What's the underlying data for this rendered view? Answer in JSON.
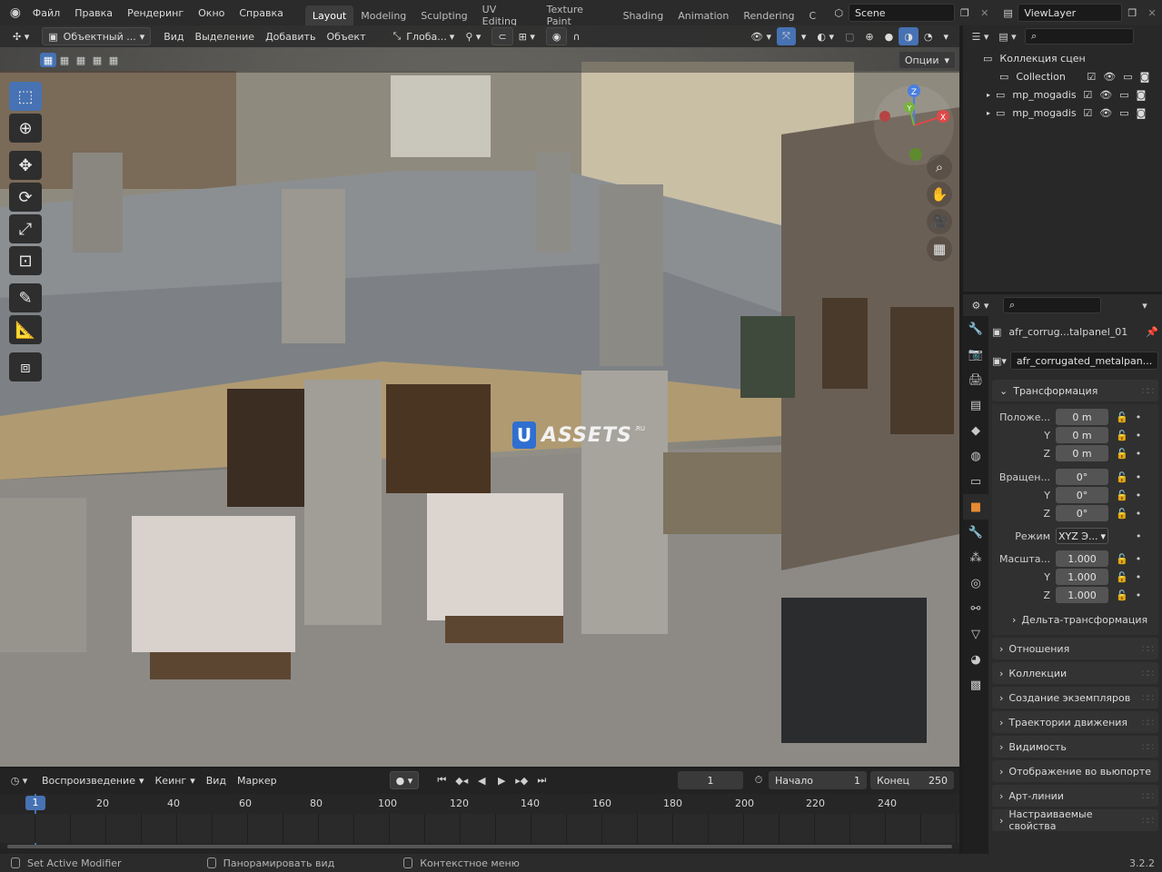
{
  "topbar": {
    "menus": [
      "Файл",
      "Правка",
      "Рендеринг",
      "Окно",
      "Справка"
    ],
    "workspaces": [
      "Layout",
      "Modeling",
      "Sculpting",
      "UV Editing",
      "Texture Paint",
      "Shading",
      "Animation",
      "Rendering",
      "C"
    ],
    "active_workspace": "Layout",
    "scene": "Scene",
    "view_layer": "ViewLayer"
  },
  "viewport": {
    "mode": "Объектный ...",
    "menus": [
      "Вид",
      "Выделение",
      "Добавить",
      "Объект"
    ],
    "transform_orientation": "Глоба...",
    "options": "Опции",
    "watermark": "ASSETS",
    "watermark_letter": "U",
    "watermark_sup": ".RU",
    "gizmo": {
      "x": "X",
      "y": "Y",
      "z": "Z"
    }
  },
  "outliner": {
    "root": "Коллекция сцен",
    "items": [
      "Collection",
      "mp_mogadish",
      "mp_mogadish"
    ]
  },
  "properties": {
    "object_name": "afr_corrug...talpanel_01",
    "mesh_name": "afr_corrugated_metalpan...",
    "transform_title": "Трансформация",
    "location_label": "Положе...",
    "rotation_label": "Вращен...",
    "scale_label": "Масшта...",
    "y": "Y",
    "z": "Z",
    "location": [
      "0 m",
      "0 m",
      "0 m"
    ],
    "rotation": [
      "0°",
      "0°",
      "0°"
    ],
    "scale": [
      "1.000",
      "1.000",
      "1.000"
    ],
    "mode_label": "Режим",
    "mode_value": "XYZ Э...",
    "delta": "Дельта-трансформация",
    "panels": [
      "Отношения",
      "Коллекции",
      "Создание экземпляров",
      "Траектории движения",
      "Видимость",
      "Отображение во вьюпорте",
      "Арт-линии",
      "Настраиваемые свойства"
    ]
  },
  "timeline": {
    "menus": [
      "Воспроизведение",
      "Кеинг",
      "Вид",
      "Маркер"
    ],
    "current_frame": "1",
    "start_label": "Начало",
    "start": "1",
    "end_label": "Конец",
    "end": "250",
    "ticks": [
      "1",
      "20",
      "40",
      "60",
      "80",
      "100",
      "120",
      "140",
      "160",
      "180",
      "200",
      "220",
      "240"
    ]
  },
  "status": {
    "left": "Set Active Modifier",
    "middle": "Панорамировать вид",
    "right": "Контекстное меню",
    "version": "3.2.2"
  }
}
